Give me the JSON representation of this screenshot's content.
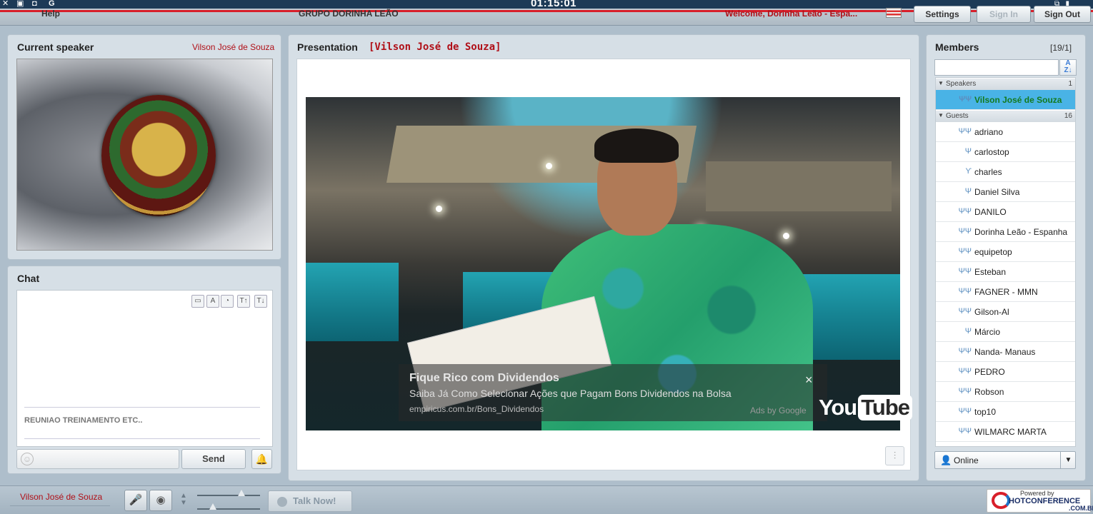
{
  "topbar": {
    "clock": "01:15:01",
    "help_label": "Help",
    "group_name": "GRUPO DORINHA LEÃO",
    "welcome_text": "Welcome, Dorinha Leão - Espa...",
    "settings_label": "Settings",
    "signin_label": "Sign In",
    "signout_label": "Sign Out",
    "system_icons_left": [
      "close-icon",
      "window-icon",
      "lock-icon",
      "g-icon"
    ],
    "system_icons_right": [
      "restore-icon",
      "pin-icon"
    ]
  },
  "speaker_panel": {
    "title": "Current speaker",
    "speaker_name": "Vilson José de Souza"
  },
  "chat_panel": {
    "title": "Chat",
    "toolbar_icons": [
      "image-icon",
      "text-color-icon",
      "clock-icon",
      "font-increase-icon",
      "font-decrease-icon"
    ],
    "messages": [
      "REUNIAO TREINAMENTO ETC.."
    ],
    "input_value": "",
    "send_label": "Send"
  },
  "presentation": {
    "title": "Presentation",
    "speaker": "[Vilson José de Souza]",
    "ad": {
      "title": "Fique Rico com Dividendos",
      "description": "Saiba Já Como Selecionar Ações que Pagam Bons Dividendos na Bolsa",
      "url": "empiricus.com.br/Bons_Dividendos",
      "label": "Ads by Google",
      "close": "×"
    },
    "youtube_you": "You",
    "youtube_tube": "Tube"
  },
  "members": {
    "title": "Members",
    "count": "[19/1]",
    "search_value": "",
    "groups": [
      {
        "name": "Speakers",
        "count": "1"
      },
      {
        "name": "Guests",
        "count": "16"
      }
    ],
    "speakers": [
      {
        "name": "Vilson José de Souza",
        "icons": "ΨΨ"
      }
    ],
    "guests": [
      {
        "name": "adriano",
        "icons": "ΨΨ"
      },
      {
        "name": "carlostop",
        "icons": "Ψ"
      },
      {
        "name": "charles",
        "icons": "ϒ"
      },
      {
        "name": "Daniel Silva",
        "icons": "Ψ"
      },
      {
        "name": "DANILO",
        "icons": "ΨΨ"
      },
      {
        "name": "Dorinha Leão - Espanha",
        "icons": "ΨΨ"
      },
      {
        "name": "equipetop",
        "icons": "ΨΨ"
      },
      {
        "name": "Esteban",
        "icons": "ΨΨ"
      },
      {
        "name": "FAGNER - MMN",
        "icons": "ΨΨ"
      },
      {
        "name": "Gilson-Al",
        "icons": "ΨΨ"
      },
      {
        "name": "Márcio",
        "icons": "Ψ"
      },
      {
        "name": "Nanda- Manaus",
        "icons": "ΨΨ"
      },
      {
        "name": "PEDRO",
        "icons": "ΨΨ"
      },
      {
        "name": "Robson",
        "icons": "ΨΨ"
      },
      {
        "name": "top10",
        "icons": "ΨΨ"
      },
      {
        "name": "WILMARC MARTA",
        "icons": "ΨΨ"
      }
    ],
    "status": "Online"
  },
  "bottombar": {
    "user_name": "Vilson José de Souza",
    "talk_label": "Talk Now!",
    "mic_volume": 0.7,
    "speaker_volume": 0.25,
    "brand_powered": "Powered by",
    "brand_name": "HOTCONFERENCE",
    "brand_domain": ".COM.BR"
  },
  "colors": {
    "accent_red": "#b01018",
    "speaker_highlight": "#49b3e6",
    "online_green": "#2f9a2f"
  }
}
